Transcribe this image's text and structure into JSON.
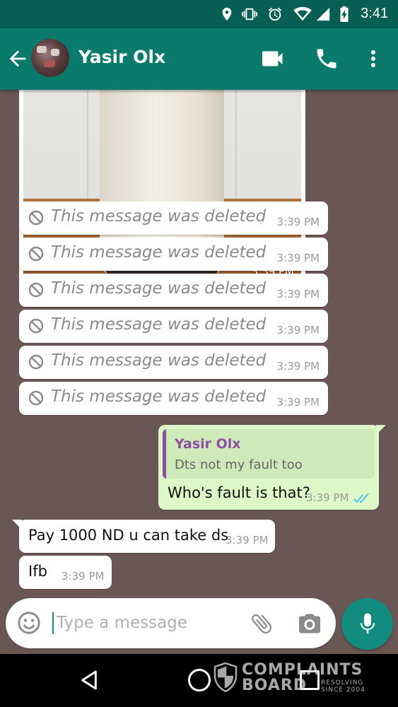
{
  "status_bar": {
    "time": "3:41",
    "icons": [
      "location-icon",
      "vibrate-icon",
      "alarm-icon",
      "wifi-icon",
      "signal-icon",
      "battery-charging-icon"
    ]
  },
  "header": {
    "contact_name": "Yasir Olx",
    "icons": [
      "back-arrow-icon",
      "video-call-icon",
      "voice-call-icon",
      "more-vert-icon"
    ]
  },
  "messages": {
    "photo": {
      "time": "3:39 PM"
    },
    "deleted": [
      {
        "text": "This message was deleted",
        "time": "3:39 PM"
      },
      {
        "text": "This message was deleted",
        "time": "3:39 PM"
      },
      {
        "text": "This message was deleted",
        "time": "3:39 PM"
      },
      {
        "text": "This message was deleted",
        "time": "3:39 PM"
      },
      {
        "text": "This message was deleted",
        "time": "3:39 PM"
      },
      {
        "text": "This message was deleted",
        "time": "3:39 PM"
      }
    ],
    "outgoing": {
      "quote_author": "Yasir Olx",
      "quote_text": "Dts not my fault too",
      "text": "Who's fault is that?",
      "time": "3:39 PM",
      "status": "read"
    },
    "incoming": [
      {
        "text": "Pay 1000 ND u can take ds",
        "time": "3:39 PM"
      },
      {
        "text": "Ifb",
        "time": "3:39 PM"
      }
    ]
  },
  "composer": {
    "placeholder": "Type a message",
    "icons": [
      "emoji-icon",
      "attach-icon",
      "camera-icon",
      "mic-icon"
    ]
  },
  "nav_bar": {
    "icons": [
      "nav-back-icon",
      "nav-home-icon",
      "nav-recents-icon"
    ]
  },
  "watermark": {
    "line1": "COMPLAINTS",
    "line2": "BOARD",
    "line3": "RESOLVING SINCE 2004"
  },
  "colors": {
    "primary": "#0a7a6c",
    "primary_dark": "#075e54",
    "accent": "#128c7e",
    "chat_background": "#6b5656",
    "outgoing_bubble": "#dcf8c6",
    "quote_author": "#8f4fa5",
    "read_ticks": "#4fc3f7"
  }
}
